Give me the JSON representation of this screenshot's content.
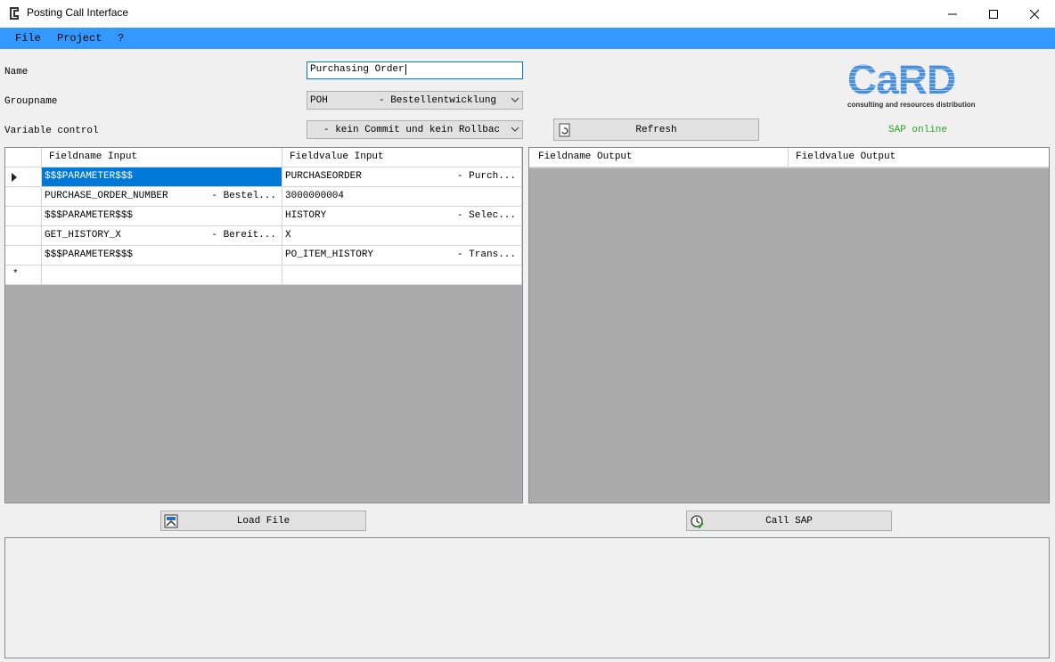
{
  "window": {
    "title": "Posting Call Interface"
  },
  "menu": [
    "File",
    "Project",
    "?"
  ],
  "form": {
    "name_label": "Name",
    "name_value": "Purchasing Order",
    "group_label": "Groupname",
    "group_value": "POH",
    "group_desc": "- Bestellentwicklung",
    "var_label": "Variable control",
    "var_value": "- kein Commit und kein Rollbac",
    "refresh": "Refresh"
  },
  "logo": {
    "text": "CaRD",
    "tagline": "consulting and resources distribution"
  },
  "status": {
    "text": "SAP online",
    "color": "#2ca02c"
  },
  "input_grid": {
    "headers": [
      "Fieldname Input",
      "Fieldvalue Input"
    ],
    "rows": [
      {
        "name": "$$$PARAMETER$$$",
        "name_desc": "",
        "value": "PURCHASEORDER",
        "value_desc": "- Purch..."
      },
      {
        "name": "PURCHASE_ORDER_NUMBER",
        "name_desc": "- Bestel...",
        "value": "3000000004",
        "value_desc": ""
      },
      {
        "name": "$$$PARAMETER$$$",
        "name_desc": "",
        "value": "HISTORY",
        "value_desc": "- Selec..."
      },
      {
        "name": "GET_HISTORY_X",
        "name_desc": "- Bereit...",
        "value": "X",
        "value_desc": ""
      },
      {
        "name": "$$$PARAMETER$$$",
        "name_desc": "",
        "value": "PO_ITEM_HISTORY",
        "value_desc": "- Trans..."
      }
    ],
    "new_row_marker": "*"
  },
  "output_grid": {
    "headers": [
      "Fieldname Output",
      "Fieldvalue Output"
    ]
  },
  "buttons": {
    "load_file": "Load File",
    "call_sap": "Call SAP"
  }
}
